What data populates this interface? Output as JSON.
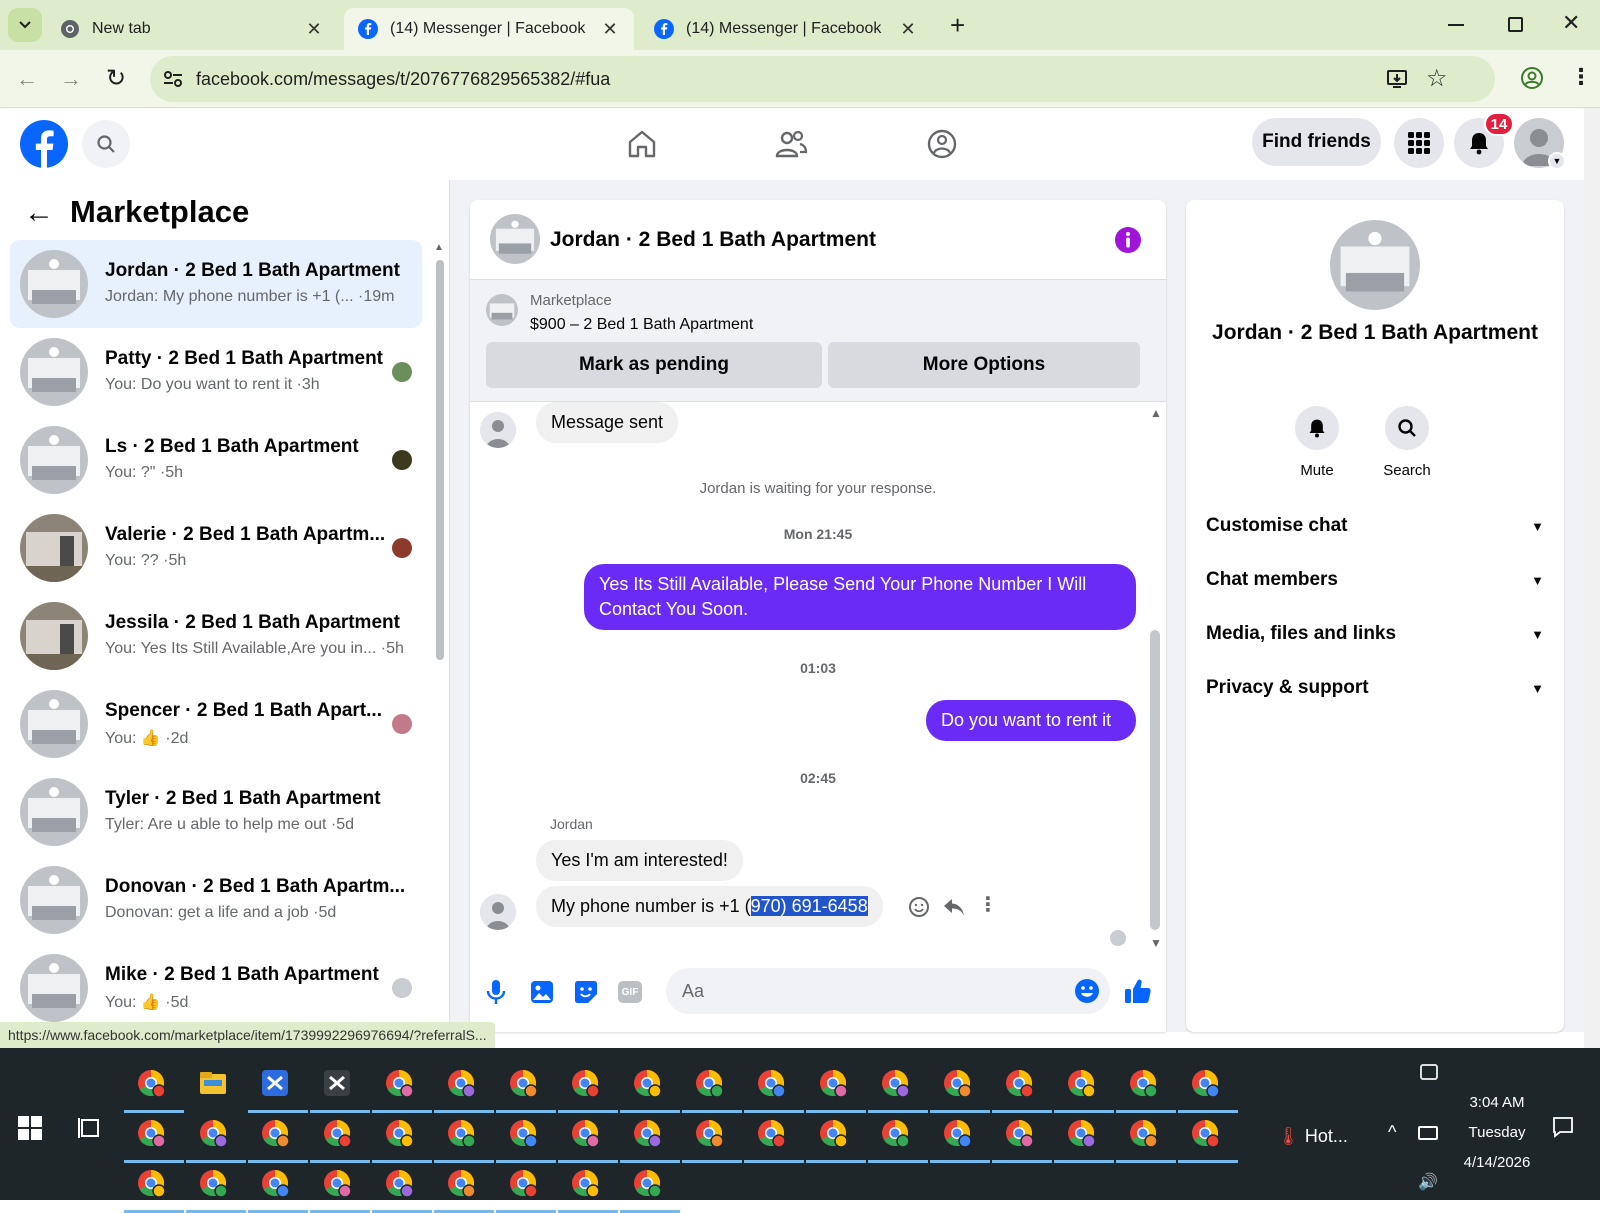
{
  "browser": {
    "tabs": [
      {
        "title": "New tab",
        "icon": "chrome-icon",
        "active": false
      },
      {
        "title": "(14) Messenger | Facebook",
        "icon": "facebook-icon",
        "active": true
      },
      {
        "title": "(14) Messenger | Facebook",
        "icon": "facebook-icon",
        "active": false
      }
    ],
    "new_tab_label": "+",
    "url": "facebook.com/messages/t/2076776829565382/#fua",
    "status_url": "https://www.facebook.com/marketplace/item/1739992296976694/?referralS..."
  },
  "fb_header": {
    "find_friends": "Find friends",
    "notification_count": "14"
  },
  "sidebar": {
    "title": "Marketplace",
    "conversations": [
      {
        "name": "Jordan · 2 Bed 1 Bath Apartment",
        "preview": "Jordan: My phone number is +1 (... ·19m",
        "active": true
      },
      {
        "name": "Patty · 2 Bed 1 Bath Apartment",
        "preview": "You: Do you want to rent it ·3h",
        "active": false
      },
      {
        "name": "Ls · 2 Bed 1 Bath Apartment",
        "preview": "You: ?\" ·5h",
        "active": false
      },
      {
        "name": "Valerie · 2 Bed 1 Bath Apartm...",
        "preview": "You: ?? ·5h",
        "active": false
      },
      {
        "name": "Jessila · 2 Bed 1 Bath Apartment",
        "preview": "You: Yes Its Still Available,Are you in... ·5h",
        "active": false
      },
      {
        "name": "Spencer · 2 Bed 1 Bath Apart...",
        "preview": "You: 👍 ·2d",
        "active": false
      },
      {
        "name": "Tyler · 2 Bed 1 Bath Apartment",
        "preview": "Tyler: Are u able to help me out ·5d",
        "active": false
      },
      {
        "name": "Donovan · 2 Bed 1 Bath Apartm...",
        "preview": "Donovan: get a life and a job ·5d",
        "active": false
      },
      {
        "name": "Mike · 2 Bed 1 Bath Apartment",
        "preview": "You: 👍 ·5d",
        "active": false
      }
    ]
  },
  "chat": {
    "title": "Jordan · 2 Bed 1 Bath Apartment",
    "listing_kicker": "Marketplace",
    "listing_title": "$900 – 2 Bed 1 Bath Apartment",
    "mark_pending": "Mark as pending",
    "more_options": "More Options",
    "messages": {
      "sent_notice": "Message sent",
      "waiting": "Jordan is waiting for your response.",
      "ts1": "Mon 21:45",
      "out1": "Yes Its Still Available, Please Send Your Phone Number I Will Contact You Soon.",
      "ts2": "01:03",
      "out2": "Do you want to rent it",
      "ts3": "02:45",
      "sender": "Jordan",
      "in1": "Yes I'm am interested!",
      "in2_prefix": "My phone number is +1 ",
      "in2_open": "(",
      "in2_selected": "970) 691-6458"
    },
    "composer_placeholder": "Aa"
  },
  "info_panel": {
    "title": "Jordan · 2 Bed 1 Bath Apartment",
    "mute": "Mute",
    "search": "Search",
    "rows": [
      "Customise chat",
      "Chat members",
      "Media, files and links",
      "Privacy & support"
    ]
  },
  "taskbar": {
    "weather": "Hot...",
    "time": "3:04 AM",
    "day": "Tuesday",
    "date": "4/14/2026"
  },
  "colors": {
    "accent": "#6b2bf7",
    "fb_blue": "#0866ff",
    "badge_red": "#e41e3f"
  }
}
